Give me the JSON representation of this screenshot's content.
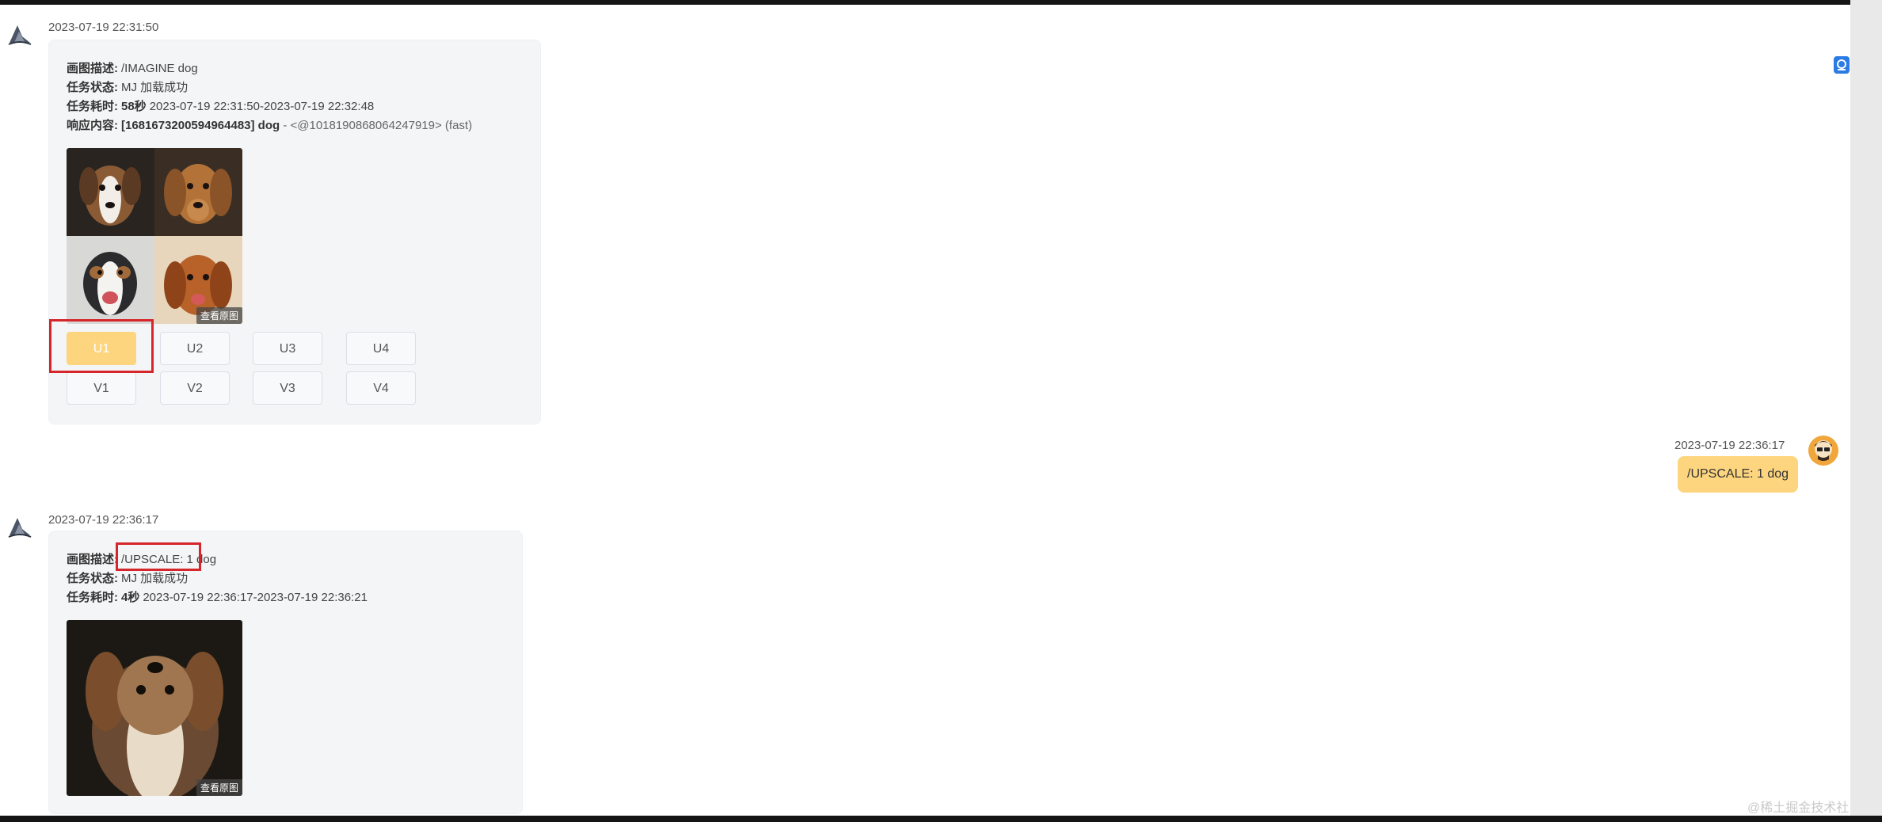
{
  "messages": [
    {
      "timestamp": "2023-07-19 22:31:50",
      "prompt_label": "画图描述:",
      "prompt_value": "/IMAGINE dog",
      "status_label": "任务状态:",
      "status_value": "MJ 加载成功",
      "time_label": "任务耗时:",
      "time_seconds": "58秒",
      "time_range": "2023-07-19 22:31:50-2023-07-19 22:32:48",
      "response_label": "响应内容:",
      "response_bold": "[1681673200594964483] dog",
      "response_rest": " - <@1018190868064247919> (fast)",
      "view_original": "查看原图",
      "buttons_row1": [
        "U1",
        "U2",
        "U3",
        "U4"
      ],
      "buttons_row2": [
        "V1",
        "V2",
        "V3",
        "V4"
      ],
      "active_button": "U1"
    },
    {
      "timestamp": "2023-07-19 22:36:17",
      "prompt_label": "画图描述:",
      "prompt_value": "/UPSCALE: 1 dog",
      "status_label": "任务状态:",
      "status_value": "MJ 加载成功",
      "time_label": "任务耗时:",
      "time_seconds": "4秒",
      "time_range": "2023-07-19 22:36:17-2023-07-19 22:36:21",
      "view_original": "查看原图"
    }
  ],
  "user_message": {
    "timestamp": "2023-07-19 22:36:17",
    "text": "/UPSCALE: 1 dog"
  },
  "watermark": "@稀土掘金技术社区",
  "colors": {
    "accent": "#fcd57e",
    "highlight": "#d6262c",
    "bubble_bg": "#f4f5f7"
  }
}
